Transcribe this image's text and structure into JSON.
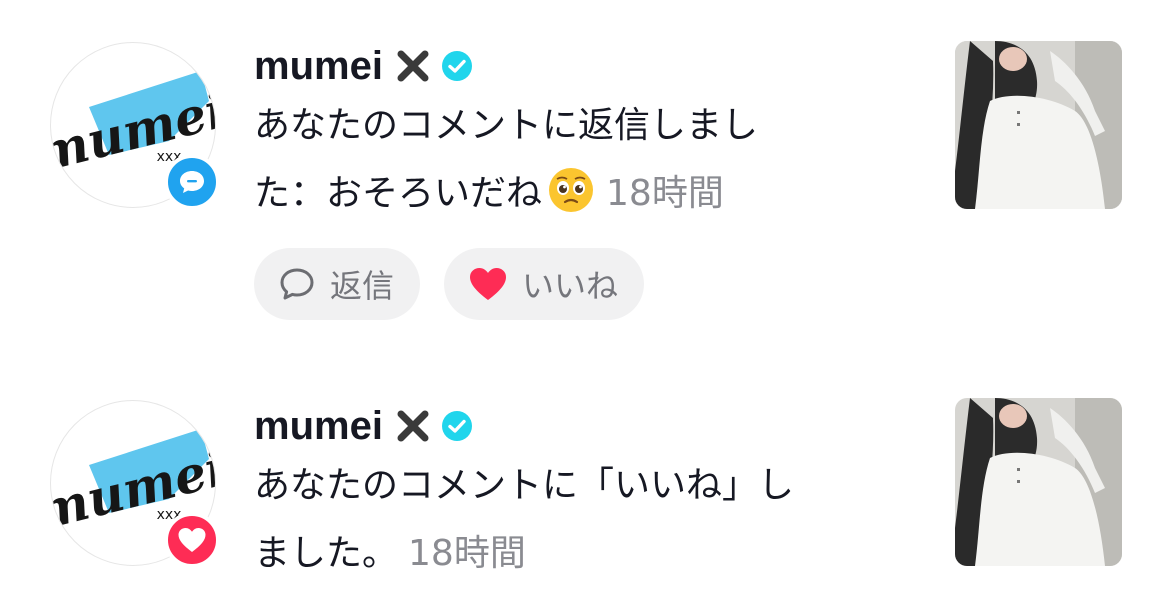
{
  "colors": {
    "comment_badge": "#20a3ef",
    "like_badge": "#fe2c55",
    "verified": "#20d5ec",
    "secondary_text": "#8a8b91",
    "pill_bg": "#f1f1f2"
  },
  "notifications": [
    {
      "type": "comment-reply",
      "username": "mumei",
      "avatar_text": "mumei",
      "avatar_sub": "xxx",
      "message_line1": "あなたのコメントに返信しまし",
      "message_line2": "た：おそろいだね",
      "emoji": "pleading-face-icon",
      "time": "18時間",
      "actions": {
        "reply_label": "返信",
        "like_label": "いいね"
      }
    },
    {
      "type": "comment-like",
      "username": "mumei",
      "avatar_text": "mumei",
      "avatar_sub": "xxx",
      "message_line1": "あなたのコメントに「いいね」し",
      "message_line2": "ました。",
      "time": "18時間"
    }
  ]
}
